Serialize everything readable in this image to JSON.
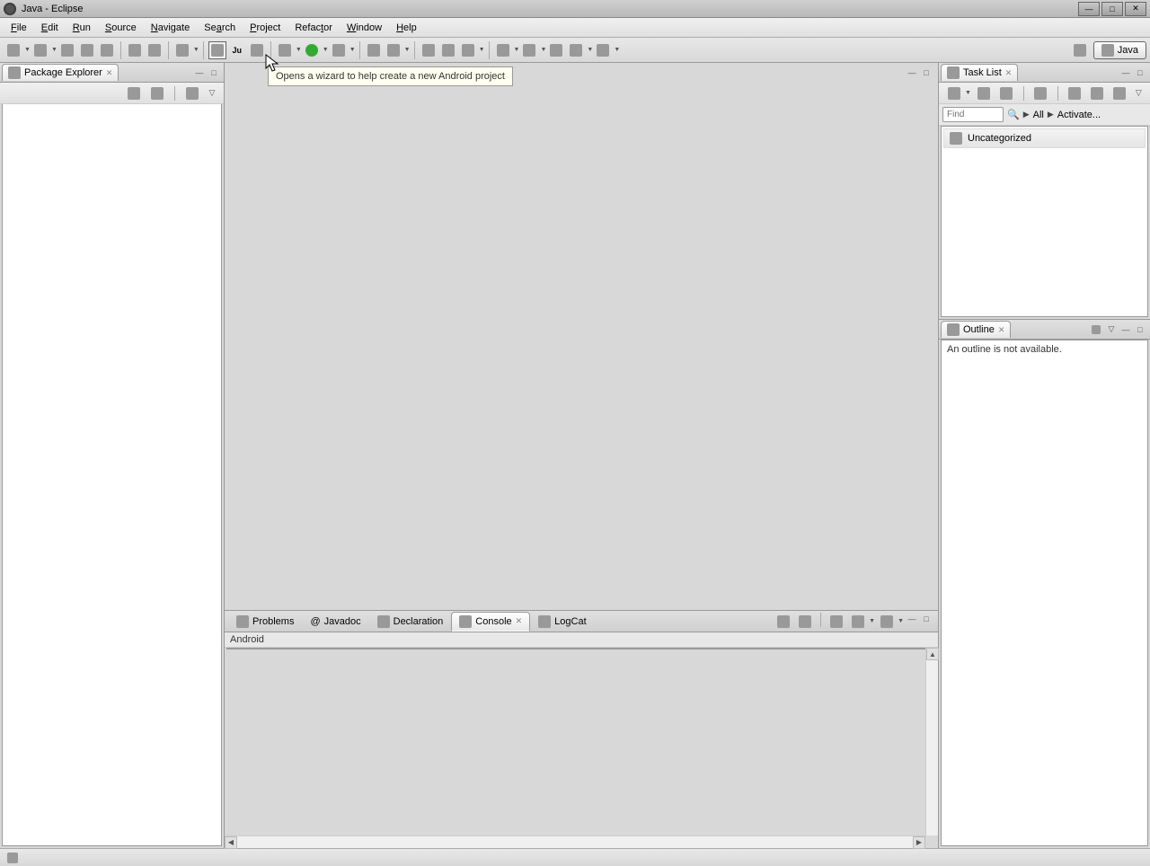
{
  "window": {
    "title": "Java - Eclipse"
  },
  "menus": {
    "file": "File",
    "edit": "Edit",
    "run": "Run",
    "source": "Source",
    "navigate": "Navigate",
    "search": "Search",
    "project": "Project",
    "refactor": "Refactor",
    "window": "Window",
    "help": "Help"
  },
  "tooltip": "Opens a wizard to help create a new Android project",
  "perspective": {
    "java": "Java"
  },
  "views": {
    "packageExplorer": {
      "title": "Package Explorer"
    },
    "taskList": {
      "title": "Task List",
      "find_placeholder": "Find",
      "all": "All",
      "activate": "Activate...",
      "category": "Uncategorized"
    },
    "outline": {
      "title": "Outline",
      "empty_message": "An outline is not available."
    }
  },
  "bottomTabs": {
    "problems": "Problems",
    "javadoc": "Javadoc",
    "declaration": "Declaration",
    "console": "Console",
    "logcat": "LogCat"
  },
  "console": {
    "header": "Android"
  },
  "status": {
    "writable": ""
  }
}
